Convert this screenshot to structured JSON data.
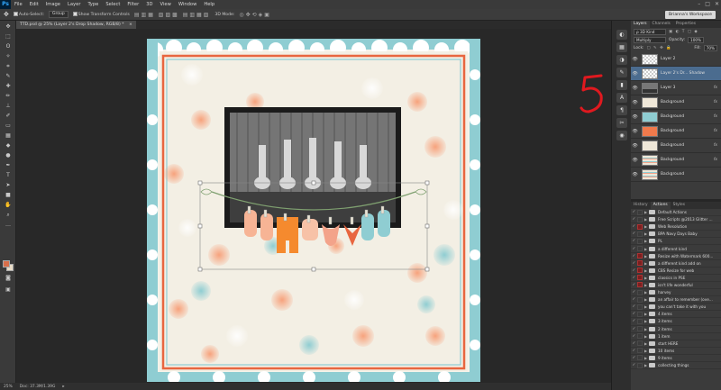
{
  "menubar": {
    "logo": "Ps",
    "items": [
      "File",
      "Edit",
      "Image",
      "Layer",
      "Type",
      "Select",
      "Filter",
      "3D",
      "View",
      "Window",
      "Help"
    ],
    "window_controls": [
      "–",
      "□",
      "✕"
    ]
  },
  "options_bar": {
    "auto_select_label": "Auto-Select:",
    "auto_select_value": "Group",
    "transform_controls_label": "Show Transform Controls",
    "mode_label": "3D Mode:",
    "workspace_button": "Brianna's Workspace"
  },
  "document_tab": {
    "label": "TTD.psd @ 25% (Layer 2's Drop Shadow, RGB/8) *",
    "close": "×"
  },
  "status_bar": {
    "zoom": "25%",
    "doc_info": "Doc: 37.3M/1.39G"
  },
  "layers_panel": {
    "tabs": [
      "Layers",
      "Channels",
      "Properties"
    ],
    "kind_label": "ρ 3D Kind",
    "blend_mode": "Multiply",
    "opacity_label": "Opacity:",
    "opacity_value": "100%",
    "lock_label": "Lock:",
    "fill_label": "Fill:",
    "fill_value": "70%",
    "layers": [
      {
        "name": "Layer 2",
        "fx": "",
        "selected": false,
        "thumb": "transparent"
      },
      {
        "name": "Layer 2's Dr... Shadow",
        "fx": "",
        "selected": true,
        "thumb": "transparent"
      },
      {
        "name": "Layer 3",
        "fx": "fx",
        "selected": false,
        "thumb": "photo"
      },
      {
        "name": "Background",
        "fx": "fx",
        "selected": false,
        "thumb": "cream"
      },
      {
        "name": "Background",
        "fx": "fx",
        "selected": false,
        "thumb": "teal"
      },
      {
        "name": "Background",
        "fx": "fx",
        "selected": false,
        "thumb": "orange"
      },
      {
        "name": "Background",
        "fx": "fx",
        "selected": false,
        "thumb": "cream"
      },
      {
        "name": "Background",
        "fx": "fx",
        "selected": false,
        "thumb": "stripe"
      },
      {
        "name": "Background",
        "fx": "",
        "selected": false,
        "thumb": "stripe"
      }
    ]
  },
  "actions_panel": {
    "tabs": [
      "History",
      "Actions",
      "Styles"
    ],
    "items": [
      {
        "label": "Default Actions",
        "red": false
      },
      {
        "label": "Free Scripts @2013 Glitter ...",
        "red": false
      },
      {
        "label": "Web Resolution",
        "red": true
      },
      {
        "label": "BPA Navy Days Baby",
        "red": false
      },
      {
        "label": "PL",
        "red": false
      },
      {
        "label": "a different kind",
        "red": false
      },
      {
        "label": "Resize with Watermark 600...",
        "red": true
      },
      {
        "label": "a different kind add on",
        "red": true
      },
      {
        "label": "CBS Resize for web",
        "red": true
      },
      {
        "label": "classics in PSE",
        "red": true
      },
      {
        "label": "isn't life wonderful",
        "red": true
      },
      {
        "label": "harvey",
        "red": false
      },
      {
        "label": "an affair to remember (ove...",
        "red": false
      },
      {
        "label": "you can't take it with you",
        "red": false
      },
      {
        "label": "4 items",
        "red": false
      },
      {
        "label": "3 items",
        "red": false
      },
      {
        "label": "2 items",
        "red": false
      },
      {
        "label": "1 item",
        "red": false
      },
      {
        "label": "start HERE",
        "red": false
      },
      {
        "label": "10 items",
        "red": false
      },
      {
        "label": "9 items",
        "red": false
      },
      {
        "label": "collecting things",
        "red": false
      }
    ]
  },
  "annotation": {
    "text": "5",
    "color": "#e0191f"
  },
  "colors": {
    "accent_selection": "#4b6c8f",
    "paper": "#f3efe4",
    "teal": "#7cc3c9",
    "orange": "#f07a4c"
  }
}
